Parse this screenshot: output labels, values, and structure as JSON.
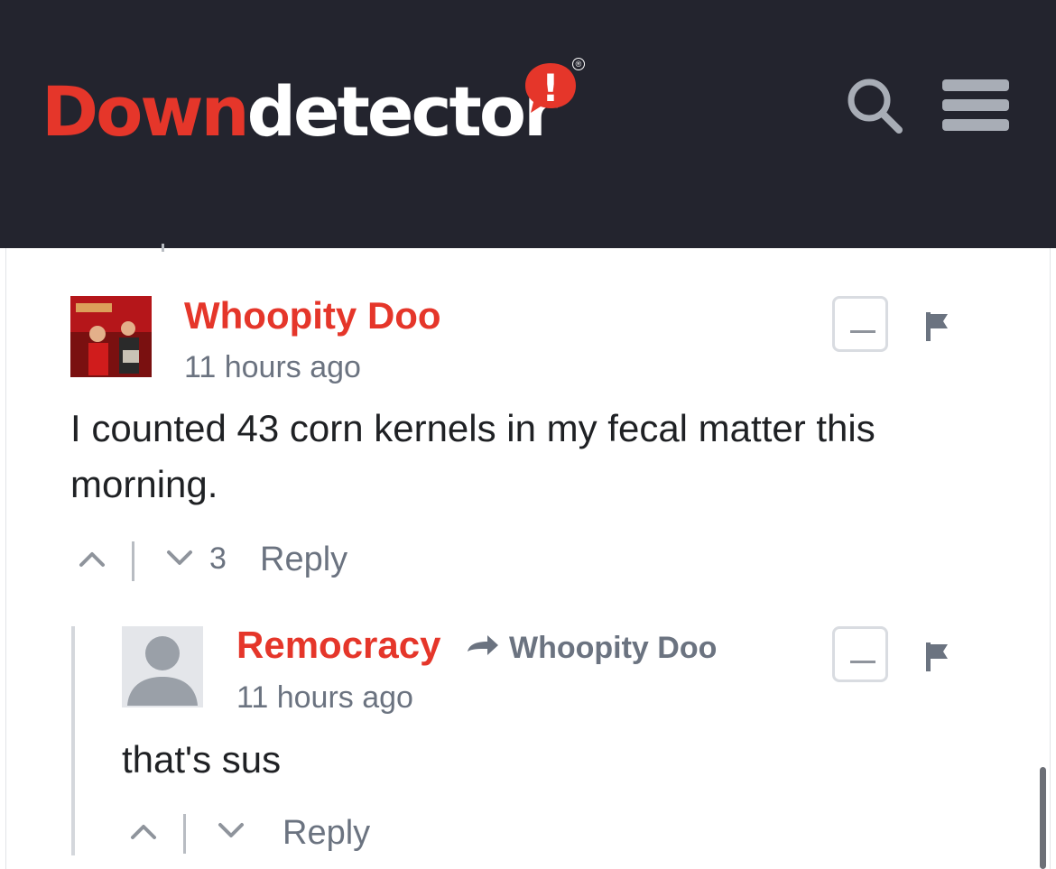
{
  "header": {
    "logo_part1": "Down",
    "logo_part2": "detector",
    "logo_badge": "!",
    "registered_mark": "®"
  },
  "colors": {
    "header_bg": "#23242e",
    "brand_red": "#e5362a",
    "muted_text": "#6b7380",
    "body_text": "#1f2124"
  },
  "icons": [
    "search-icon",
    "menu-icon",
    "flag-icon",
    "upvote-icon",
    "downvote-icon",
    "reply-arrow-icon",
    "avatar-placeholder-icon"
  ],
  "comments": [
    {
      "author": "Whoopity Doo",
      "time": "11 hours ago",
      "text_line1": "I counted 43 corn kernels in my fecal matter this",
      "text_line2": "morning.",
      "vote_count": "3",
      "reply_label": "Reply"
    },
    {
      "author": "Remocracy",
      "in_reply_to": "Whoopity Doo",
      "time": "11 hours ago",
      "text": "that's sus",
      "reply_label": "Reply"
    }
  ]
}
